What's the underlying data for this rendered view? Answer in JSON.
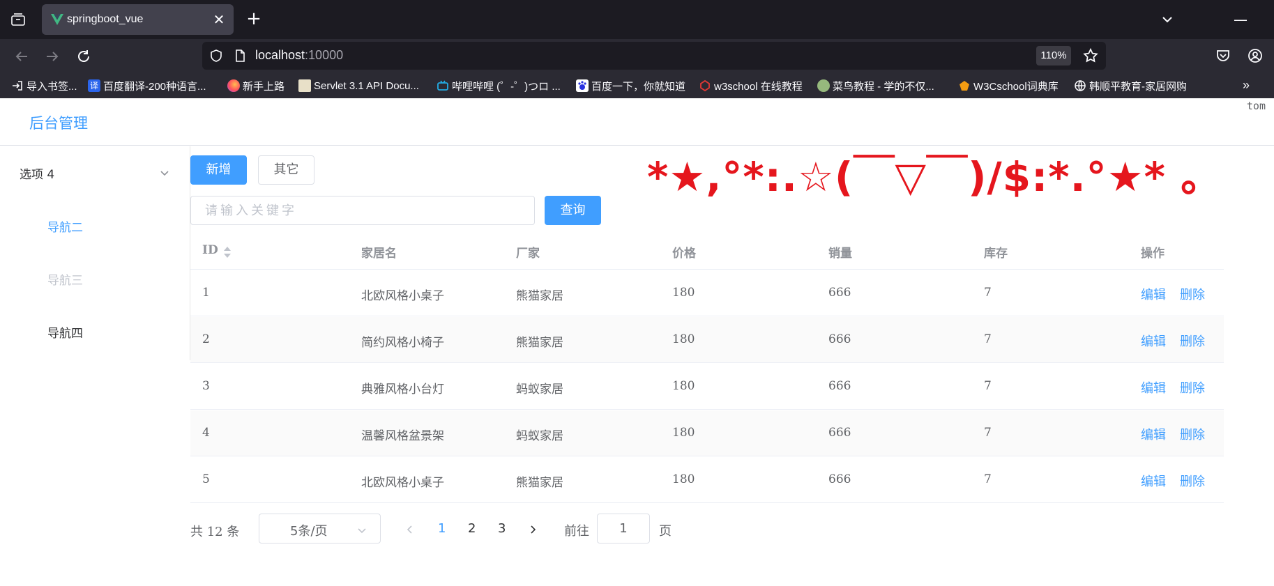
{
  "browser": {
    "tab_title": "springboot_vue",
    "url_host": "localhost",
    "url_port": ":10000",
    "zoom": "110%",
    "bookmarks": [
      {
        "label": "导入书签...",
        "icon": "import-icon"
      },
      {
        "label": "百度翻译-200种语言...",
        "icon": "baidu-translate-icon",
        "icon_text": "译"
      },
      {
        "label": "新手上路",
        "icon": "firefox-icon"
      },
      {
        "label": "Servlet 3.1 API Docu...",
        "icon": "java-icon"
      },
      {
        "label": "哔哩哔哩 (゜-゜)つロ ...",
        "icon": "bilibili-icon"
      },
      {
        "label": "百度一下，你就知道",
        "icon": "baidu-icon"
      },
      {
        "label": "w3school 在线教程",
        "icon": "w3school-icon"
      },
      {
        "label": "菜鸟教程 - 学的不仅...",
        "icon": "runoob-icon"
      },
      {
        "label": "W3Cschool词典库",
        "icon": "w3cschool-icon"
      },
      {
        "label": "韩顺平教育-家居网购",
        "icon": "globe-icon"
      }
    ]
  },
  "header": {
    "brand": "后台管理",
    "user": "tom"
  },
  "sidebar": {
    "submenu_title": "选项 4",
    "items": [
      {
        "label": "导航二",
        "state": "active"
      },
      {
        "label": "导航三",
        "state": "disabled"
      },
      {
        "label": "导航四",
        "state": "normal"
      }
    ]
  },
  "toolbar": {
    "add_label": "新增",
    "other_label": "其它",
    "search_placeholder": "请输入关键字",
    "search_button": "查询"
  },
  "decoration": "*★,°*:.☆(￣▽￣)/$:*.°★* 。",
  "table": {
    "columns": [
      "ID",
      "家居名",
      "厂家",
      "价格",
      "销量",
      "库存",
      "操作"
    ],
    "rows": [
      {
        "id": "1",
        "name": "北欧风格小桌子",
        "maker": "熊猫家居",
        "price": "180",
        "sales": "666",
        "stock": "7"
      },
      {
        "id": "2",
        "name": "简约风格小椅子",
        "maker": "熊猫家居",
        "price": "180",
        "sales": "666",
        "stock": "7"
      },
      {
        "id": "3",
        "name": "典雅风格小台灯",
        "maker": "蚂蚁家居",
        "price": "180",
        "sales": "666",
        "stock": "7"
      },
      {
        "id": "4",
        "name": "温馨风格盆景架",
        "maker": "蚂蚁家居",
        "price": "180",
        "sales": "666",
        "stock": "7"
      },
      {
        "id": "5",
        "name": "北欧风格小桌子",
        "maker": "熊猫家居",
        "price": "180",
        "sales": "666",
        "stock": "7"
      }
    ],
    "edit_label": "编辑",
    "delete_label": "删除"
  },
  "pagination": {
    "total_text": "共 12 条",
    "page_size": "5条/页",
    "pages": [
      "1",
      "2",
      "3"
    ],
    "current_page": "1",
    "goto_label": "前往",
    "goto_value": "1",
    "page_suffix": "页"
  },
  "colors": {
    "primary": "#409eff",
    "decoration": "#e5161d",
    "chrome_dark": "#1c1b22"
  }
}
